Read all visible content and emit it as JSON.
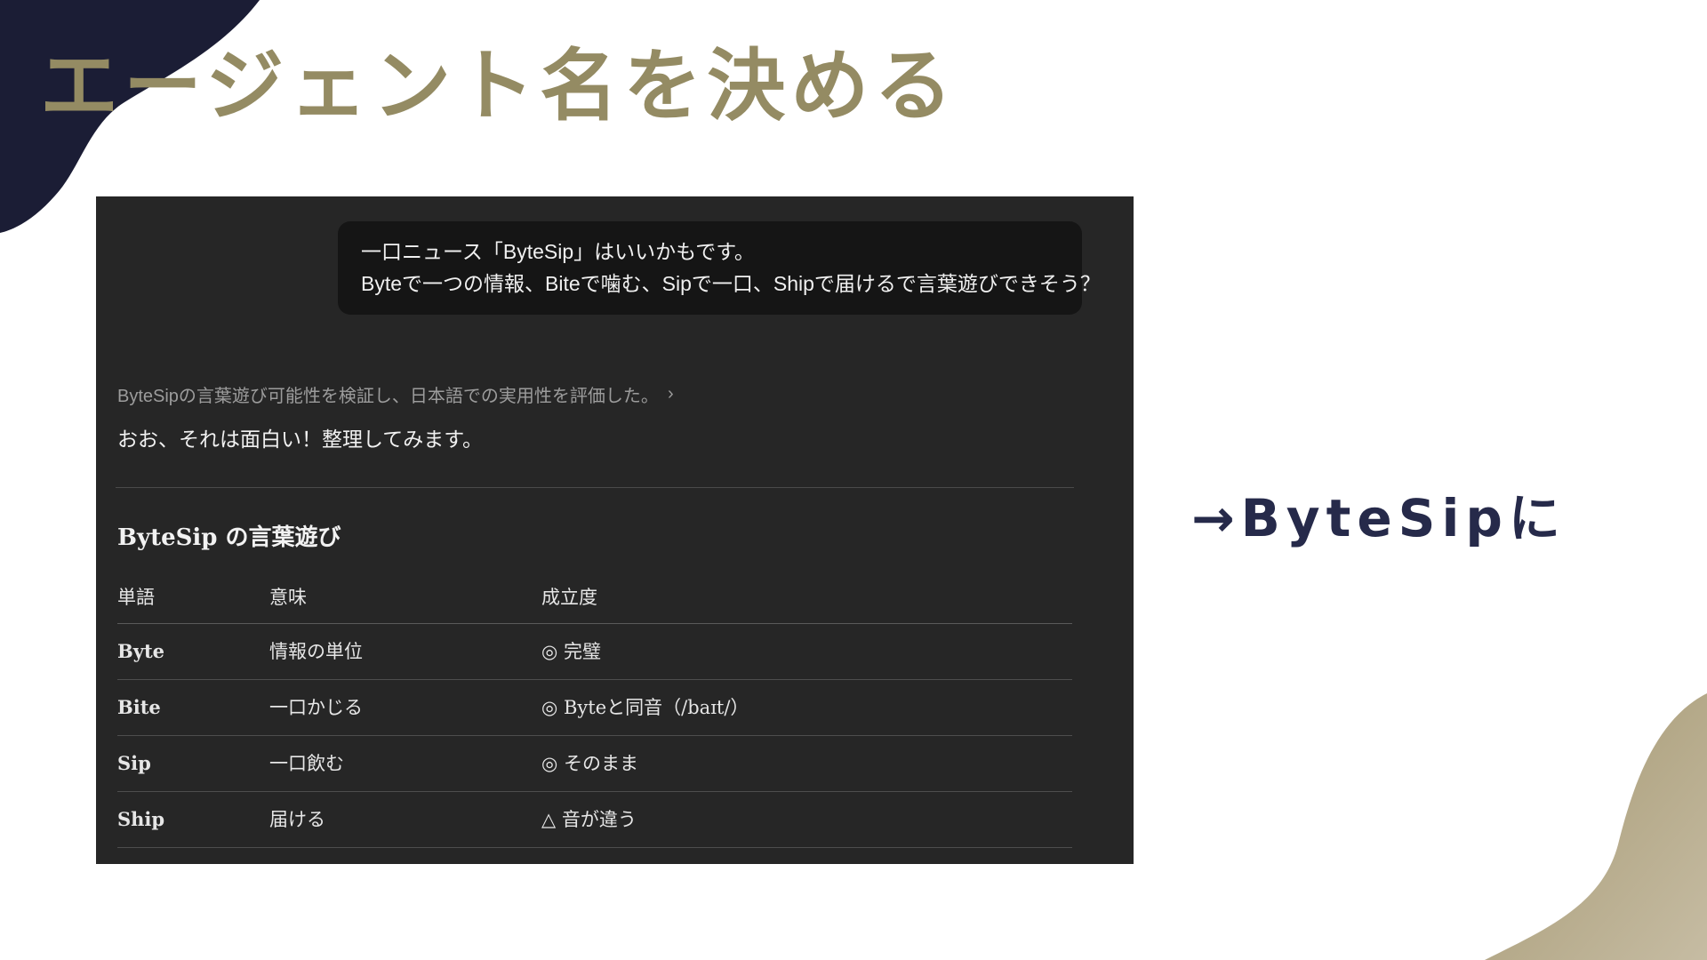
{
  "title": "エージェント名を決める",
  "colors": {
    "title": "#948b63",
    "navy_blob": "#1b1d35",
    "gold_blob": "#a99c7a",
    "panel_bg": "#262626",
    "bubble_bg": "#151515",
    "callout": "#262a4a"
  },
  "chat": {
    "user_message": {
      "line1": "一口ニュース「ByteSip」はいいかもです。",
      "line2": "Byteで一つの情報、Biteで噛む、Sipで一口、Shipで届けるで言葉遊びできそう？"
    },
    "thinking_summary": "ByteSipの言葉遊び可能性を検証し、日本語での実用性を評価した。",
    "chevron_icon": "chevron-right-icon",
    "reply_intro": "おお、それは面白い！整理してみます。",
    "section_heading": "ByteSip の言葉遊び",
    "table": {
      "headers": [
        "単語",
        "意味",
        "成立度"
      ],
      "rows": [
        [
          "Byte",
          "情報の単位",
          "◎ 完璧"
        ],
        [
          "Bite",
          "一口かじる",
          "◎ Byteと同音（/baɪt/）"
        ],
        [
          "Sip",
          "一口飲む",
          "◎ そのまま"
        ],
        [
          "Ship",
          "届ける",
          "△ 音が違う"
        ]
      ]
    }
  },
  "callout": "→ByteSipに"
}
